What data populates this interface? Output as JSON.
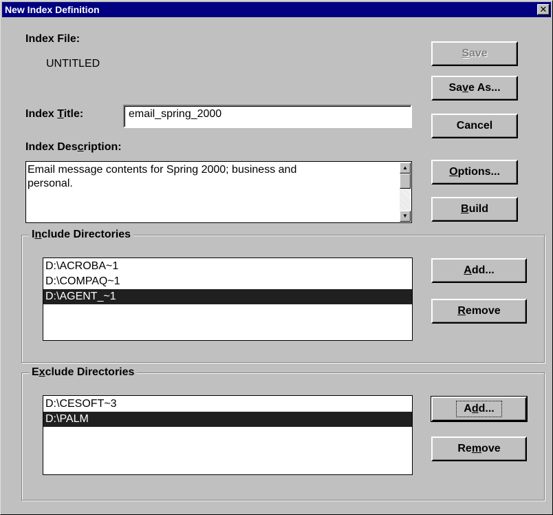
{
  "window": {
    "title": "New Index Definition",
    "close_glyph": "✕"
  },
  "index_file": {
    "label": "Index File:",
    "value": "UNTITLED"
  },
  "index_title": {
    "label_pre": "Index ",
    "label_mnemonic": "T",
    "label_post": "itle:",
    "value": "email_spring_2000"
  },
  "index_description": {
    "label_pre": "Index Des",
    "label_mnemonic": "c",
    "label_post": "ription:",
    "line1": "Email message contents for Spring 2000; business and",
    "line2": "personal."
  },
  "buttons": {
    "save": {
      "mnemonic": "S",
      "rest": "ave",
      "enabled": false
    },
    "save_as": {
      "pre": "Sa",
      "mnemonic": "v",
      "post": "e As..."
    },
    "cancel": "Cancel",
    "options": {
      "mnemonic": "O",
      "rest": "ptions..."
    },
    "build": {
      "mnemonic": "B",
      "rest": "uild"
    }
  },
  "include": {
    "title_pre": "I",
    "title_mnemonic": "n",
    "title_post": "clude Directories",
    "items": [
      "D:\\ACROBA~1",
      "D:\\COMPAQ~1",
      "D:\\AGENT_~1"
    ],
    "selected_index": 2,
    "add": {
      "mnemonic": "A",
      "rest": "dd..."
    },
    "remove": {
      "mnemonic": "R",
      "rest": "emove"
    }
  },
  "exclude": {
    "title_pre": "E",
    "title_mnemonic": "x",
    "title_post": "clude Directories",
    "items": [
      "D:\\CESOFT~3",
      "D:\\PALM"
    ],
    "selected_index": 1,
    "add": {
      "pre": "A",
      "mnemonic": "d",
      "post": "d..."
    },
    "remove": {
      "pre": "Re",
      "mnemonic": "m",
      "post": "ove"
    }
  },
  "colors": {
    "dialog_face": "#c0c0c0",
    "titlebar": "#000080",
    "selection": "#202020"
  }
}
